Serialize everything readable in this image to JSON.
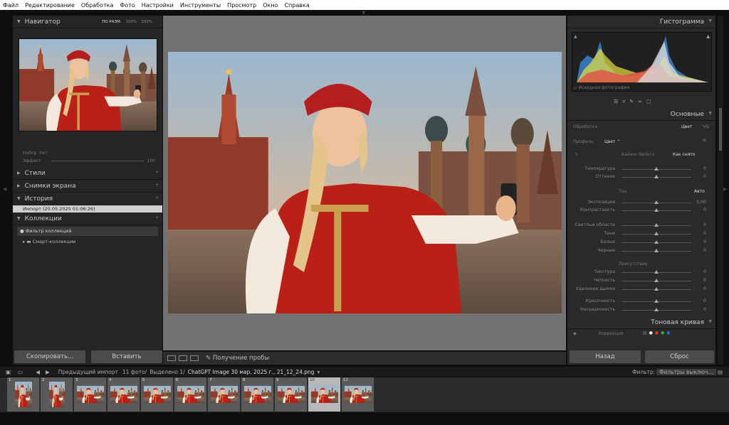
{
  "menu": [
    "Файл",
    "Редактирование",
    "Обработка",
    "Фото",
    "Настройки",
    "Инструменты",
    "Просмотр",
    "Окно",
    "Справка"
  ],
  "left": {
    "navigator": {
      "title": "Навигатор",
      "zoom": [
        "ПО РАЗМ.",
        "100%",
        "300%"
      ]
    },
    "preset": {
      "name_label": "Набор",
      "name_value": "Нет",
      "effect_label": "Эффект",
      "effect_value": "100"
    },
    "styles": "Стили",
    "snapshots": "Снимки экрана",
    "history": "История",
    "history_item": "Импорт (20.05.2025 01:06:26)",
    "collections": "Коллекции",
    "collection_filter": "Фильтр коллекций",
    "smart_collections": "Смарт-коллекции",
    "copy": "Скопировать...",
    "paste": "Вставить"
  },
  "toolbar": {
    "label": "Получение пробы"
  },
  "right": {
    "histogram": "Гистограмма",
    "source": "Исходная фотография",
    "basic": "Основные",
    "treatment": "Обработка",
    "color": "Цвет",
    "bw": "Ч/Б",
    "profile": "Профиль",
    "profile_value": "Цвет",
    "wb": "Баланс белого",
    "wb_value": "Как снято",
    "temp": "Температура",
    "tint": "Оттенок",
    "tone": "Тон",
    "auto": "Авто",
    "exposure": "Экспозиция",
    "exposure_value": "0,00",
    "contrast": "Контрастность",
    "highlights": "Светлые области",
    "shadows": "Тени",
    "whites": "Белые",
    "blacks": "Черные",
    "presence": "Присутствие",
    "texture": "Текстура",
    "clarity": "Четкость",
    "dehaze": "Удаление дымки",
    "vibrance": "Красочность",
    "saturation": "Насыщенность",
    "zero": "0",
    "curve": "Тоновая кривая",
    "correction": "Коррекция",
    "back": "Назад",
    "reset": "Сброс"
  },
  "filmbar": {
    "prev": "Предыдущий импорт",
    "count": "11 фото/",
    "selected": "Выделено 1/",
    "file": "ChatGPT Image 30 мар. 2025 г., 21_12_24.png",
    "filter_label": "Фильтр:",
    "filter_value": "Фильтры выключ..."
  },
  "film": [
    "1",
    "2",
    "3",
    "4",
    "5",
    "6",
    "7",
    "8",
    "9",
    "10",
    "11"
  ]
}
